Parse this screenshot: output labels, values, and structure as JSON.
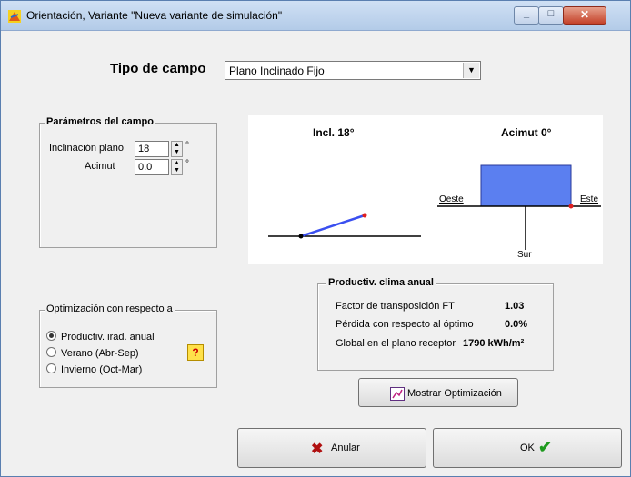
{
  "window": {
    "title": "Orientación, Variante \"Nueva variante de simulación\""
  },
  "tipo": {
    "label": "Tipo de campo",
    "value": "Plano Inclinado Fijo"
  },
  "params": {
    "legend": "Parámetros del campo",
    "incl_label": "Inclinación plano",
    "incl_value": "18",
    "azim_label": "Acimut",
    "azim_value": "0.0",
    "unit": "°"
  },
  "diagram": {
    "incl_title": "Incl. 18°",
    "azim_title": "Acimut 0°",
    "oeste": "Oeste",
    "este": "Este",
    "sur": "Sur"
  },
  "opt": {
    "legend": "Optimización con respecto a",
    "options": [
      {
        "label": "Productiv. irad. anual",
        "selected": true
      },
      {
        "label": "Verano (Abr-Sep)",
        "selected": false
      },
      {
        "label": "Invierno (Oct-Mar)",
        "selected": false
      }
    ]
  },
  "prod": {
    "legend": "Productiv. clima anual",
    "rows": [
      {
        "label": "Factor de transposición FT",
        "value": "1.03"
      },
      {
        "label": "Pérdida con respecto al óptimo",
        "value": "0.0%"
      },
      {
        "label": "Global en el plano receptor",
        "value": "1790 kWh/m²"
      }
    ]
  },
  "buttons": {
    "mostrar": "Mostrar Optimización",
    "anular": "Anular",
    "ok": "OK"
  },
  "colors": {
    "panel": "#5b7ff0",
    "marker": "#e02020",
    "accent": "#3a4ff0"
  }
}
